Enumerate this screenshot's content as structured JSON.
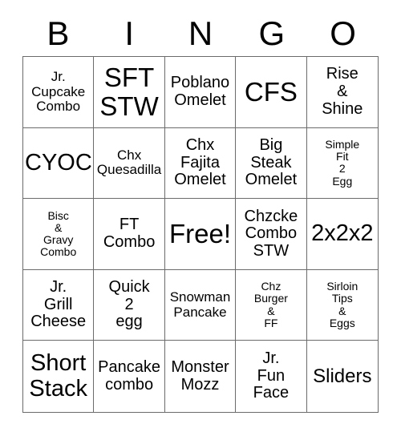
{
  "card": {
    "title": "BINGO",
    "header_letters": [
      "B",
      "I",
      "N",
      "G",
      "O"
    ],
    "free_space_label": "Free!",
    "rows": [
      [
        {
          "text": "Jr.\nCupcake\nCombo",
          "size": "sm"
        },
        {
          "text": "SFT\nSTW",
          "size": "xxl"
        },
        {
          "text": "Poblano\nOmelet",
          "size": "md"
        },
        {
          "text": "CFS",
          "size": "xxl"
        },
        {
          "text": "Rise\n&\nShine",
          "size": "md"
        }
      ],
      [
        {
          "text": "CYOC",
          "size": "xl"
        },
        {
          "text": "Chx\nQuesadilla",
          "size": "sm"
        },
        {
          "text": "Chx\nFajita\nOmelet",
          "size": "md"
        },
        {
          "text": "Big\nSteak\nOmelet",
          "size": "md"
        },
        {
          "text": "Simple\nFit\n2\nEgg",
          "size": "xs"
        }
      ],
      [
        {
          "text": "Bisc\n&\nGravy\nCombo",
          "size": "xs"
        },
        {
          "text": "FT\nCombo",
          "size": "md"
        },
        {
          "text": "Free!",
          "size": "xxl"
        },
        {
          "text": "Chzcke\nCombo\nSTW",
          "size": "md"
        },
        {
          "text": "2x2x2",
          "size": "xl"
        }
      ],
      [
        {
          "text": "Jr.\nGrill\nCheese",
          "size": "md"
        },
        {
          "text": "Quick\n2\negg",
          "size": "md"
        },
        {
          "text": "Snowman\nPancake",
          "size": "sm"
        },
        {
          "text": "Chz\nBurger\n&\nFF",
          "size": "xs"
        },
        {
          "text": "Sirloin\nTips\n&\nEggs",
          "size": "xs"
        }
      ],
      [
        {
          "text": "Short\nStack",
          "size": "xl"
        },
        {
          "text": "Pancake\ncombo",
          "size": "md"
        },
        {
          "text": "Monster\nMozz",
          "size": "md"
        },
        {
          "text": "Jr.\nFun\nFace",
          "size": "md"
        },
        {
          "text": "Sliders",
          "size": "lg"
        }
      ]
    ]
  }
}
